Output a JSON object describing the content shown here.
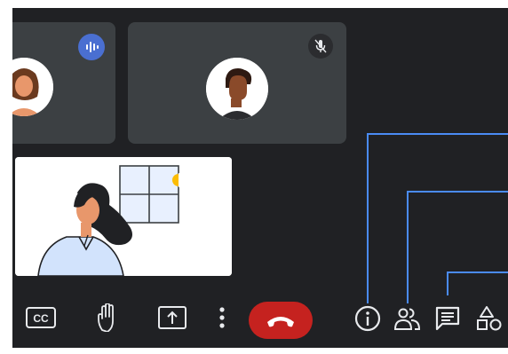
{
  "colors": {
    "background": "#202124",
    "tile": "#3c4043",
    "end_call": "#c5221f",
    "speaking_badge": "#4a6fd1",
    "guide_lines": "#4a8bf5",
    "icon": "#e8eaed"
  },
  "participants": [
    {
      "role": "remote",
      "speaking": true,
      "avatar": "woman-avatar"
    },
    {
      "role": "remote",
      "muted": true,
      "avatar": "man-avatar"
    },
    {
      "role": "self",
      "illustration": "woman-at-window"
    }
  ],
  "controls": {
    "left": [
      {
        "name": "cc-button",
        "icon": "closed-captions-icon",
        "label": "CC"
      },
      {
        "name": "raise-hand-button",
        "icon": "hand-icon"
      },
      {
        "name": "present-button",
        "icon": "present-screen-icon"
      },
      {
        "name": "more-options-button",
        "icon": "more-vert-icon"
      },
      {
        "name": "end-call-button",
        "icon": "phone-hangup-icon"
      }
    ],
    "right": [
      {
        "name": "info-button",
        "icon": "info-icon"
      },
      {
        "name": "people-button",
        "icon": "people-icon"
      },
      {
        "name": "chat-button",
        "icon": "chat-icon"
      },
      {
        "name": "activities-button",
        "icon": "shapes-icon"
      }
    ]
  },
  "cc_label": "CC"
}
